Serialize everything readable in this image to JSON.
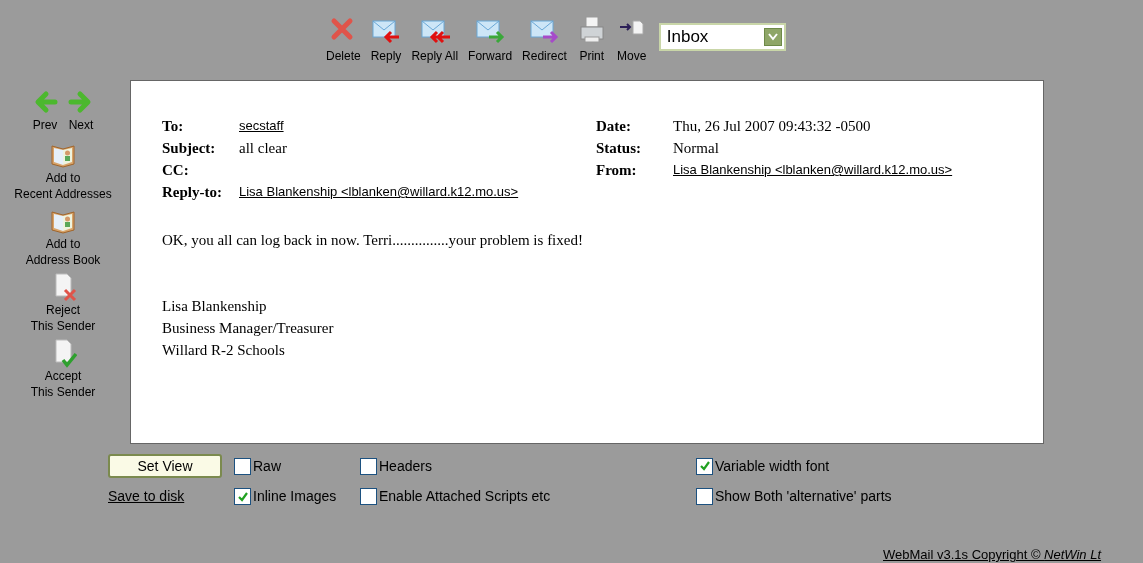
{
  "toolbar": [
    {
      "kind": "delete",
      "label": "Delete"
    },
    {
      "kind": "reply",
      "label": "Reply"
    },
    {
      "kind": "replyall",
      "label": "Reply All"
    },
    {
      "kind": "forward",
      "label": "Forward"
    },
    {
      "kind": "redirect",
      "label": "Redirect"
    },
    {
      "kind": "print",
      "label": "Print"
    },
    {
      "kind": "move",
      "label": "Move"
    }
  ],
  "folder_select": {
    "value": "Inbox"
  },
  "nav": [
    {
      "kind": "prev",
      "label": "Prev"
    },
    {
      "kind": "next",
      "label": "Next"
    }
  ],
  "sidebar": [
    {
      "kind": "book",
      "label": "Add to\nRecent Addresses"
    },
    {
      "kind": "book",
      "label": "Add to\nAddress Book"
    },
    {
      "kind": "reject",
      "label": "Reject\nThis Sender"
    },
    {
      "kind": "accept",
      "label": "Accept\nThis Sender"
    }
  ],
  "headers_left": [
    {
      "name": "To:",
      "value": "secstaff",
      "link": true
    },
    {
      "name": "Subject:",
      "value": "all clear",
      "link": false
    },
    {
      "name": "CC:"
    },
    {
      "name": "Reply-to:",
      "value": "Lisa Blankenship <lblanken@willard.k12.mo.us>",
      "link": true
    }
  ],
  "headers_right": [
    {
      "name": "Date:",
      "value": "Thu, 26 Jul 2007 09:43:32 -0500",
      "link": false
    },
    {
      "name": "Status:",
      "value": "Normal",
      "link": false
    },
    {
      "name": "From:",
      "value": "Lisa Blankenship <lblanken@willard.k12.mo.us>",
      "link": true
    }
  ],
  "body": [
    "OK, you all can log back in now. Terri...............your problem is fixed!"
  ],
  "signature": [
    "Lisa Blankenship",
    "Business Manager/Treasurer",
    "Willard R-2 Schools"
  ],
  "set_view_button": "Set View",
  "save_link": "Save to disk",
  "options": [
    {
      "label": "Raw",
      "checked": false
    },
    {
      "label": "Headers",
      "checked": false
    },
    {
      "label": "Variable width font",
      "checked": true
    },
    {
      "label": "Inline Images",
      "checked": true
    },
    {
      "label": "Enable Attached Scripts etc",
      "checked": false
    },
    {
      "label": "Show Both 'alternative' parts",
      "checked": false
    }
  ],
  "footer": "WebMail v3.1s Copyright © *NetWin Lt*"
}
